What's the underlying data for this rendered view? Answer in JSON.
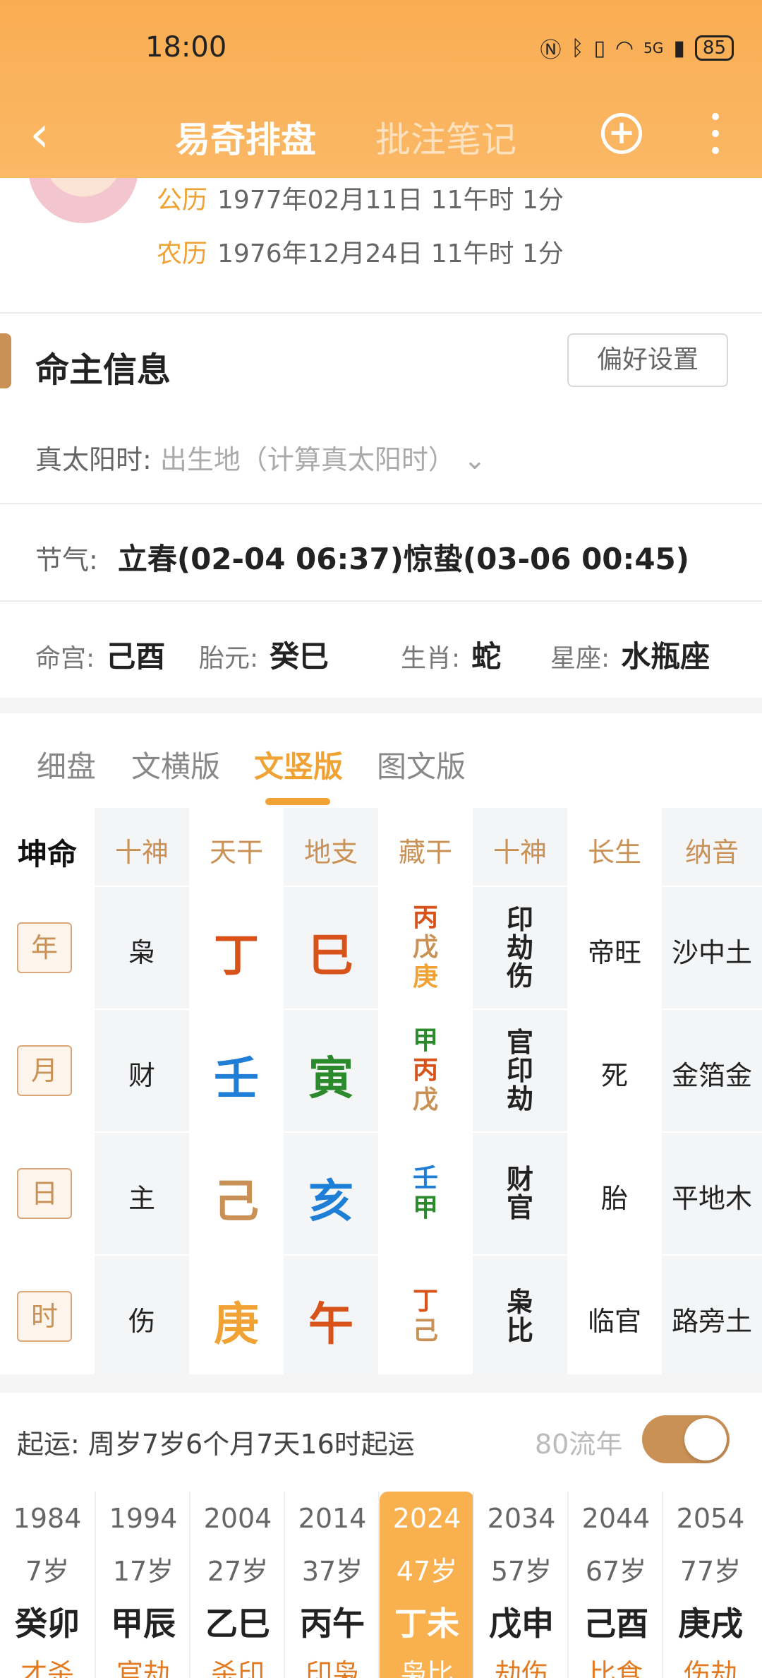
{
  "status": {
    "time": "18:00",
    "battery": "85",
    "network": "5G"
  },
  "nav": {
    "back": "‹",
    "title": "易奇排盘",
    "notes": "批注笔记",
    "add": "+"
  },
  "profile": {
    "solar_label": "公历",
    "solar_value": "1977年02月11日 11午时 1分",
    "lunar_label": "农历",
    "lunar_value": "1976年12月24日 11午时 1分"
  },
  "section": {
    "title": "命主信息",
    "pref_button": "偏好设置"
  },
  "solar_time": {
    "label": "真太阳时:",
    "placeholder": "出生地（计算真太阳时）",
    "chevron": "⌄"
  },
  "solar_term": {
    "label": "节气:",
    "value": "立春(02-04 06:37)惊蛰(03-06 00:45)"
  },
  "attributes": [
    {
      "label": "命宫:",
      "value": "己酉"
    },
    {
      "label": "胎元:",
      "value": "癸巳"
    },
    {
      "label": "生肖:",
      "value": "蛇"
    },
    {
      "label": "星座:",
      "value": "水瓶座"
    }
  ],
  "tabs": [
    "细盘",
    "文横版",
    "文竖版",
    "图文版"
  ],
  "active_tab": 2,
  "table": {
    "corner": "坤命",
    "headers": [
      "十神",
      "天干",
      "地支",
      "藏干",
      "十神",
      "长生",
      "纳音"
    ],
    "rows": [
      {
        "pillar": "年",
        "god": "枭",
        "stem": "丁",
        "stem_color": "#d8531a",
        "branch": "巳",
        "branch_color": "#d8531a",
        "hidden": [
          {
            "t": "丙",
            "c": "#d8531a"
          },
          {
            "t": "戊",
            "c": "#c99155"
          },
          {
            "t": "庚",
            "c": "#f0a235"
          }
        ],
        "gods2": [
          "印",
          "劫",
          "伤"
        ],
        "changsheng": "帝旺",
        "nayin": "沙中土"
      },
      {
        "pillar": "月",
        "god": "财",
        "stem": "壬",
        "stem_color": "#1f7fd6",
        "branch": "寅",
        "branch_color": "#2b8a2b",
        "hidden": [
          {
            "t": "甲",
            "c": "#2b8a2b"
          },
          {
            "t": "丙",
            "c": "#d8531a"
          },
          {
            "t": "戊",
            "c": "#c99155"
          }
        ],
        "gods2": [
          "官",
          "印",
          "劫"
        ],
        "changsheng": "死",
        "nayin": "金箔金"
      },
      {
        "pillar": "日",
        "god": "主",
        "stem": "己",
        "stem_color": "#c99155",
        "branch": "亥",
        "branch_color": "#1f7fd6",
        "hidden": [
          {
            "t": "壬",
            "c": "#1f7fd6"
          },
          {
            "t": "甲",
            "c": "#2b8a2b"
          }
        ],
        "gods2": [
          "财",
          "官"
        ],
        "changsheng": "胎",
        "nayin": "平地木"
      },
      {
        "pillar": "时",
        "god": "伤",
        "stem": "庚",
        "stem_color": "#f0a235",
        "branch": "午",
        "branch_color": "#d8531a",
        "hidden": [
          {
            "t": "丁",
            "c": "#d8531a"
          },
          {
            "t": "己",
            "c": "#c99155"
          }
        ],
        "gods2": [
          "枭",
          "比"
        ],
        "changsheng": "临官",
        "nayin": "路旁土"
      }
    ]
  },
  "qiyun": {
    "text": "起运:  周岁7岁6个月7天16时起运",
    "liunian_label": "80流年",
    "toggle_on": true
  },
  "dayun": [
    {
      "year": "1984",
      "age": "7岁",
      "gz": "癸卯",
      "ss": "才杀"
    },
    {
      "year": "1994",
      "age": "17岁",
      "gz": "甲辰",
      "ss": "官劫"
    },
    {
      "year": "2004",
      "age": "27岁",
      "gz": "乙巳",
      "ss": "杀印"
    },
    {
      "year": "2014",
      "age": "37岁",
      "gz": "丙午",
      "ss": "印枭"
    },
    {
      "year": "2024",
      "age": "47岁",
      "gz": "丁未",
      "ss": "枭比"
    },
    {
      "year": "2034",
      "age": "57岁",
      "gz": "戊申",
      "ss": "劫伤"
    },
    {
      "year": "2044",
      "age": "67岁",
      "gz": "己酉",
      "ss": "比食"
    },
    {
      "year": "2054",
      "age": "77岁",
      "gz": "庚戌",
      "ss": "伤劫"
    }
  ],
  "selected_dayun": 4
}
